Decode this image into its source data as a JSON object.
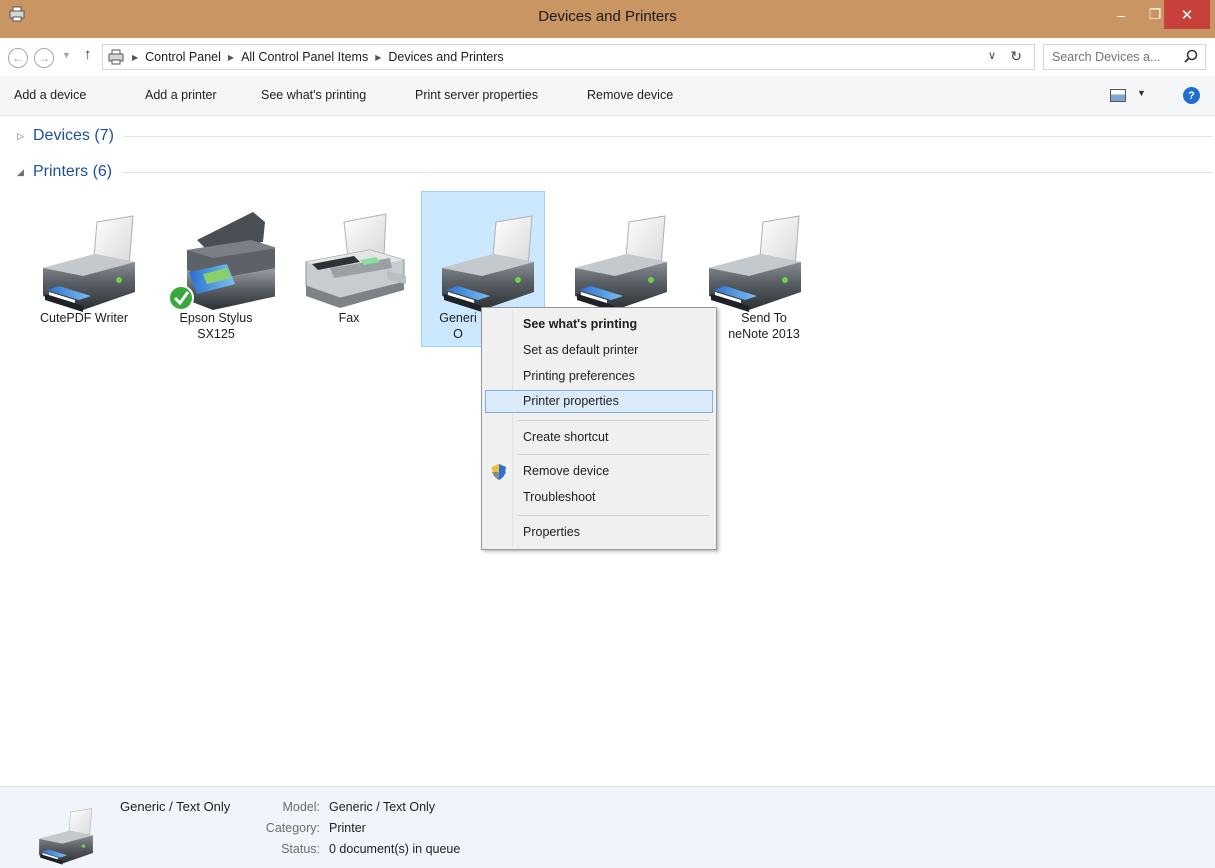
{
  "window": {
    "title": "Devices and Printers",
    "min_glyph": "–",
    "max_glyph": "❐",
    "close_glyph": "✕"
  },
  "address": {
    "breadcrumbs": [
      "Control Panel",
      "All Control Panel Items",
      "Devices and Printers"
    ],
    "search_placeholder": "Search Devices a..."
  },
  "toolbar": {
    "add_device": "Add a device",
    "add_printer": "Add a printer",
    "see_printing": "See what's printing",
    "print_server": "Print server properties",
    "remove_device": "Remove device"
  },
  "groups": {
    "devices_label": "Devices (7)",
    "printers_label": "Printers (6)"
  },
  "printers": [
    {
      "name": "CutePDF Writer",
      "icon": "printer-icon"
    },
    {
      "name": "Epson Stylus SX125",
      "icon": "inkjet-printer-icon",
      "default": true
    },
    {
      "name": "Fax",
      "icon": "fax-icon"
    },
    {
      "name": "Generi\nO",
      "icon": "printer-icon",
      "selected": true
    },
    {
      "name": "",
      "icon": "printer-icon"
    },
    {
      "name": "Send To\nneNote 2013",
      "icon": "printer-icon"
    }
  ],
  "context_menu": {
    "items": [
      {
        "label": "See what's printing",
        "bold": true
      },
      {
        "label": "Set as default printer"
      },
      {
        "label": "Printing preferences"
      },
      {
        "label": "Printer properties",
        "highlighted": true
      },
      {
        "label": "Create shortcut"
      },
      {
        "label": "Remove device",
        "icon": "uac-shield-icon"
      },
      {
        "label": "Troubleshoot"
      },
      {
        "label": "Properties"
      }
    ]
  },
  "details": {
    "name": "Generic / Text Only",
    "model_label": "Model:",
    "model": "Generic / Text Only",
    "category_label": "Category:",
    "category": "Printer",
    "status_label": "Status:",
    "status": "0 document(s) in queue"
  },
  "colors": {
    "titlebar": "#c99562",
    "close_button": "#c7403a",
    "selection": "#cce8ff",
    "group_header": "#1e4e9c"
  }
}
